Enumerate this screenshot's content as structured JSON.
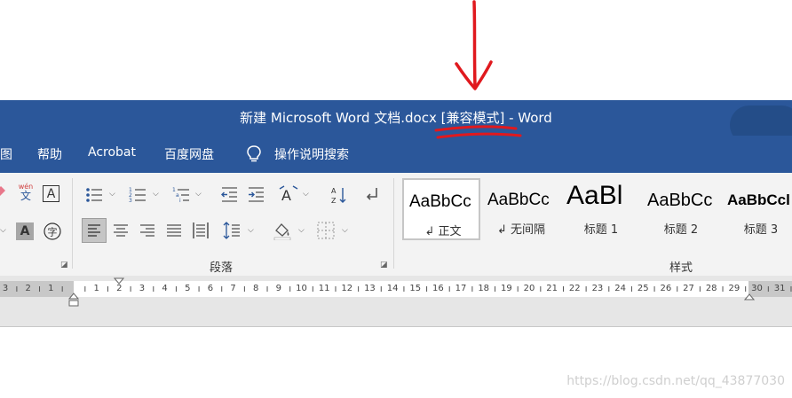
{
  "window": {
    "title": "新建 Microsoft Word 文档.docx [兼容模式]  -  Word"
  },
  "menu_tabs": [
    {
      "label": "图"
    },
    {
      "label": "帮助"
    },
    {
      "label": "Acrobat"
    },
    {
      "label": "百度网盘"
    },
    {
      "label": "操作说明搜索"
    }
  ],
  "ribbon": {
    "font_group": {
      "phonetic_icon_text": "wén",
      "phonetic_char": "文",
      "char_border_char": "A",
      "char_shading_char": "A",
      "enclose_char": "字"
    },
    "paragraph_group": {
      "label": "段落"
    },
    "styles_group": {
      "label": "样式",
      "items": [
        {
          "preview": "AaBbCc",
          "name": "正文",
          "mark": "↲"
        },
        {
          "preview": "AaBbCc",
          "name": "无间隔",
          "mark": "↲"
        },
        {
          "preview": "AaBl",
          "name": "标题 1"
        },
        {
          "preview": "AaBbCc",
          "name": "标题 2"
        },
        {
          "preview": "AaBbCcl",
          "name": "标题 3"
        }
      ]
    }
  },
  "ruler": {
    "left_numbers": [
      "3",
      "2",
      "1"
    ],
    "numbers": [
      "2",
      "3",
      "4",
      "5",
      "6",
      "7",
      "8",
      "9",
      "10",
      "11",
      "12",
      "13",
      "14",
      "15",
      "16",
      "17",
      "18",
      "19",
      "20",
      "21",
      "22",
      "23",
      "24",
      "25",
      "26",
      "27",
      "28",
      "29"
    ],
    "right_numbers": [
      "30",
      "31"
    ]
  },
  "watermark": "https://blog.csdn.net/qq_43877030",
  "colors": {
    "title_bar": "#2b579a",
    "annotation": "#e0191e",
    "ribbon": "#f3f3f3"
  }
}
